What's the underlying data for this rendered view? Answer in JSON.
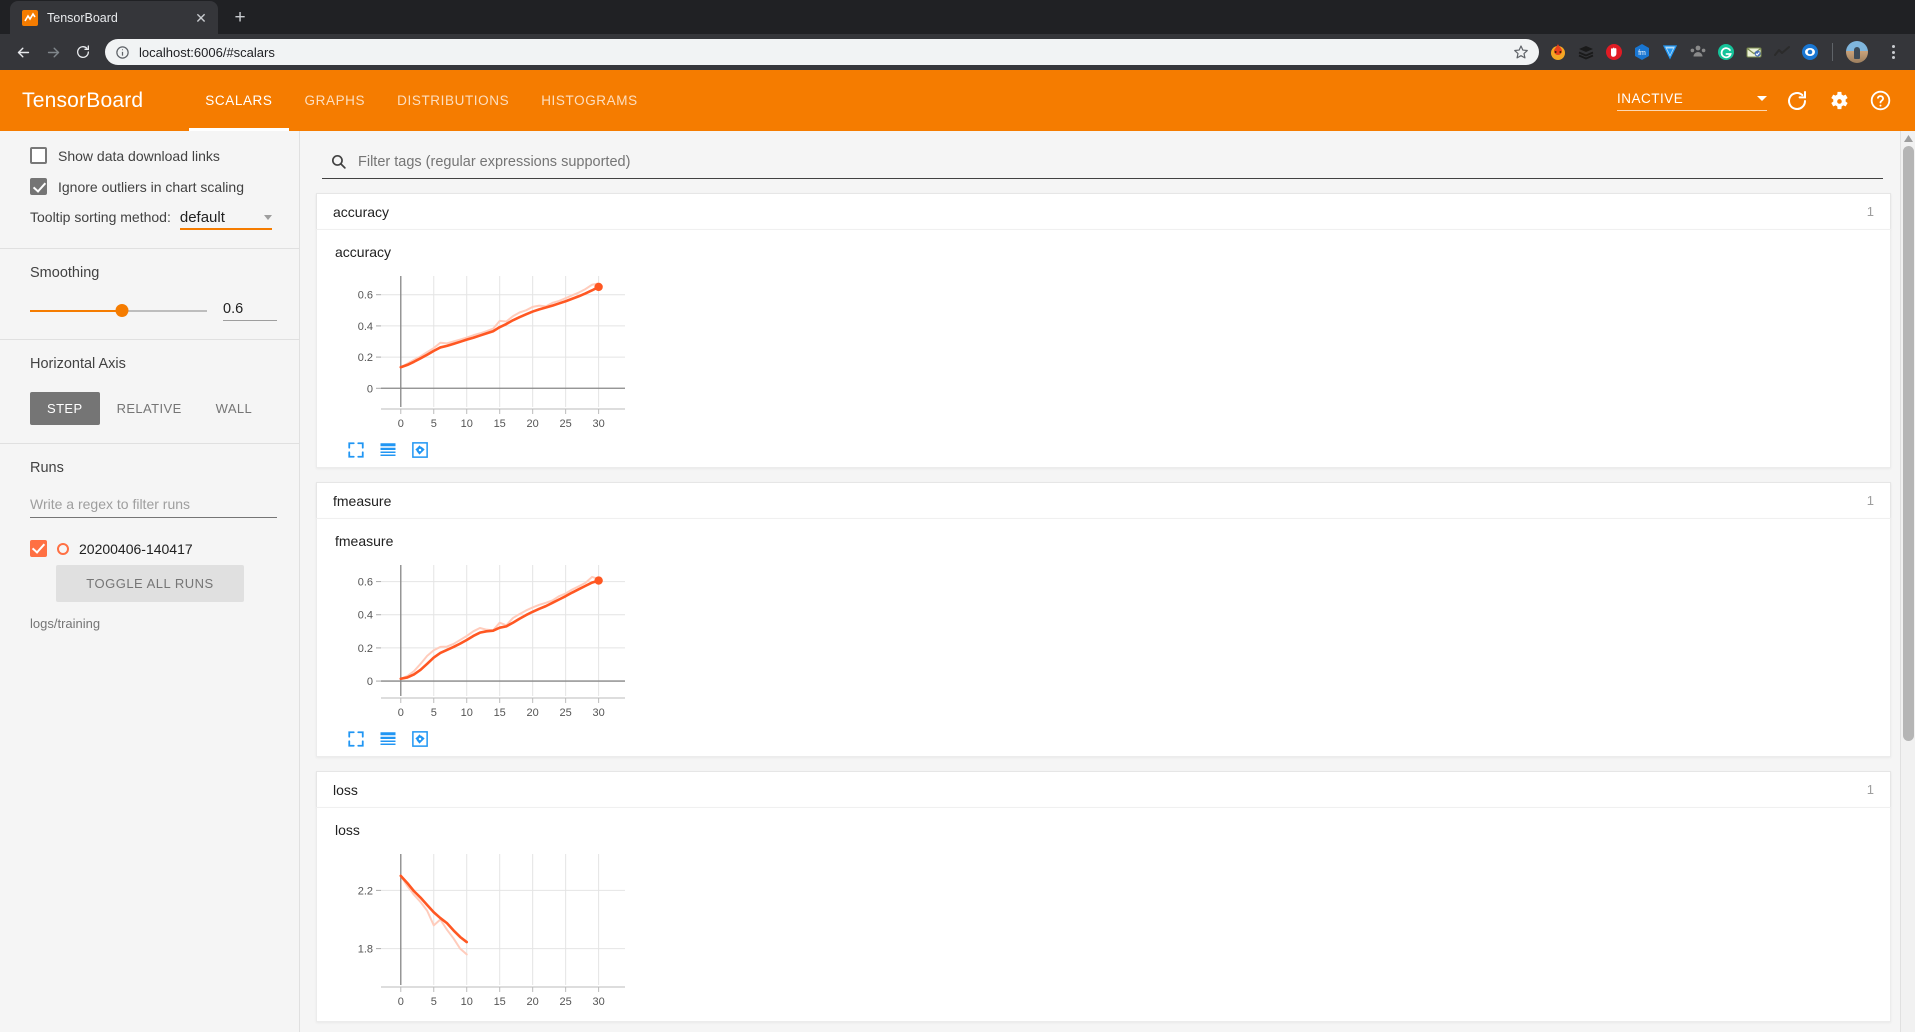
{
  "browser": {
    "tab": {
      "title": "TensorBoard",
      "favicon_icon": "tensorboard-favicon",
      "close_icon": "close-icon"
    },
    "new_tab_label": "+",
    "nav": {
      "back_icon": "back-arrow-icon",
      "forward_icon": "forward-arrow-icon",
      "reload_icon": "reload-icon"
    },
    "omnibox": {
      "url": "localhost:6006/#scalars",
      "info_icon": "site-info-icon",
      "star_icon": "bookmark-star-icon"
    },
    "extensions": [
      "extension-flame-icon",
      "extension-stack-icon",
      "extension-stophand-icon",
      "extension-fm-icon",
      "extension-shield-icon",
      "extension-people-icon",
      "extension-grammarly-icon",
      "extension-mail-icon",
      "extension-wave-icon",
      "extension-eye-icon"
    ],
    "profile_icon": "profile-avatar",
    "menu_icon": "browser-menu-icon"
  },
  "header": {
    "logo": "TensorBoard",
    "tabs": [
      {
        "label": "SCALARS",
        "active": true
      },
      {
        "label": "GRAPHS",
        "active": false
      },
      {
        "label": "DISTRIBUTIONS",
        "active": false
      },
      {
        "label": "HISTOGRAMS",
        "active": false
      }
    ],
    "status_select": {
      "value": "INACTIVE",
      "caret_icon": "chevron-down-icon"
    },
    "refresh_icon": "refresh-icon",
    "settings_icon": "gear-icon",
    "help_icon": "help-circle-icon",
    "brand_color": "#f57c00"
  },
  "sidebar": {
    "show_download_links": {
      "label": "Show data download links",
      "checked": false
    },
    "ignore_outliers": {
      "label": "Ignore outliers in chart scaling",
      "checked": true
    },
    "tooltip_sorting": {
      "label": "Tooltip sorting method:",
      "value": "default",
      "caret_icon": "chevron-down-icon"
    },
    "smoothing": {
      "title": "Smoothing",
      "value": "0.6",
      "percent": 52
    },
    "horizontal_axis": {
      "title": "Horizontal Axis",
      "options": [
        {
          "label": "STEP",
          "active": true
        },
        {
          "label": "RELATIVE",
          "active": false
        },
        {
          "label": "WALL",
          "active": false
        }
      ]
    },
    "runs": {
      "title": "Runs",
      "filter_placeholder": "Write a regex to filter runs",
      "items": [
        {
          "name": "20200406-140417",
          "checked": true,
          "color": "#ff7043"
        }
      ],
      "toggle_all_label": "TOGGLE ALL RUNS",
      "logdir": "logs/training"
    }
  },
  "main": {
    "filter": {
      "placeholder": "Filter tags (regular expressions supported)",
      "icon": "search-icon",
      "value": ""
    },
    "groups": [
      {
        "title": "accuracy",
        "count": "1"
      },
      {
        "title": "fmeasure",
        "count": "1"
      },
      {
        "title": "loss",
        "count": "1"
      }
    ],
    "chart_tools": [
      "fullscreen-expand-icon",
      "data-table-icon",
      "fit-domain-icon"
    ],
    "scrollbar": {
      "up_arrow_icon": "scroll-up-arrow-icon"
    }
  },
  "chart_data": [
    {
      "type": "line",
      "title": "accuracy",
      "xlabel": "",
      "ylabel": "",
      "xlim": [
        -3,
        34
      ],
      "ylim": [
        -0.12,
        0.72
      ],
      "xticks": [
        0,
        5,
        10,
        15,
        20,
        25,
        30
      ],
      "yticks": [
        0,
        0.2,
        0.4,
        0.6
      ],
      "grid": true,
      "legend": "none",
      "series": [
        {
          "name": "20200406-140417 (raw)",
          "color": "#ffccbc",
          "x": [
            0,
            1,
            2,
            3,
            4,
            5,
            6,
            7,
            8,
            9,
            10,
            11,
            12,
            13,
            14,
            15,
            16,
            17,
            18,
            19,
            20,
            21,
            22,
            23,
            24,
            25,
            26,
            27,
            28,
            29,
            30
          ],
          "y": [
            0.135,
            0.158,
            0.182,
            0.205,
            0.232,
            0.258,
            0.292,
            0.288,
            0.3,
            0.312,
            0.325,
            0.34,
            0.352,
            0.366,
            0.382,
            0.432,
            0.428,
            0.462,
            0.486,
            0.5,
            0.522,
            0.53,
            0.525,
            0.548,
            0.56,
            0.578,
            0.596,
            0.614,
            0.636,
            0.664,
            0.672
          ]
        },
        {
          "name": "20200406-140417 (smoothed)",
          "color": "#ff5722",
          "x": [
            0,
            1,
            2,
            3,
            4,
            5,
            6,
            7,
            8,
            9,
            10,
            11,
            12,
            13,
            14,
            15,
            16,
            17,
            18,
            19,
            20,
            21,
            22,
            23,
            24,
            25,
            26,
            27,
            28,
            29,
            30
          ],
          "y": [
            0.135,
            0.15,
            0.17,
            0.192,
            0.215,
            0.24,
            0.262,
            0.272,
            0.285,
            0.298,
            0.312,
            0.324,
            0.338,
            0.352,
            0.366,
            0.392,
            0.412,
            0.436,
            0.456,
            0.474,
            0.492,
            0.506,
            0.518,
            0.53,
            0.544,
            0.558,
            0.574,
            0.59,
            0.608,
            0.628,
            0.65
          ]
        }
      ],
      "end_marker": {
        "x": 30,
        "y": 0.65,
        "color": "#ff5722"
      }
    },
    {
      "type": "line",
      "title": "fmeasure",
      "xlabel": "",
      "ylabel": "",
      "xlim": [
        -3,
        34
      ],
      "ylim": [
        -0.09,
        0.7
      ],
      "xticks": [
        0,
        5,
        10,
        15,
        20,
        25,
        30
      ],
      "yticks": [
        0,
        0.2,
        0.4,
        0.6
      ],
      "grid": true,
      "legend": "none",
      "series": [
        {
          "name": "20200406-140417 (raw)",
          "color": "#ffccbc",
          "x": [
            0,
            1,
            2,
            3,
            4,
            5,
            6,
            7,
            8,
            9,
            10,
            11,
            12,
            13,
            14,
            15,
            16,
            17,
            18,
            19,
            20,
            21,
            22,
            23,
            24,
            25,
            26,
            27,
            28,
            29,
            30
          ],
          "y": [
            0.014,
            0.03,
            0.06,
            0.104,
            0.152,
            0.186,
            0.206,
            0.208,
            0.224,
            0.248,
            0.272,
            0.3,
            0.32,
            0.31,
            0.306,
            0.352,
            0.336,
            0.38,
            0.404,
            0.426,
            0.444,
            0.46,
            0.472,
            0.486,
            0.512,
            0.528,
            0.552,
            0.572,
            0.592,
            0.628,
            0.616
          ]
        },
        {
          "name": "20200406-140417 (smoothed)",
          "color": "#ff5722",
          "x": [
            0,
            1,
            2,
            3,
            4,
            5,
            6,
            7,
            8,
            9,
            10,
            11,
            12,
            13,
            14,
            15,
            16,
            17,
            18,
            19,
            20,
            21,
            22,
            23,
            24,
            25,
            26,
            27,
            28,
            29,
            30
          ],
          "y": [
            0.014,
            0.022,
            0.04,
            0.068,
            0.104,
            0.142,
            0.17,
            0.188,
            0.206,
            0.226,
            0.248,
            0.272,
            0.292,
            0.3,
            0.304,
            0.322,
            0.33,
            0.352,
            0.376,
            0.398,
            0.418,
            0.436,
            0.452,
            0.472,
            0.492,
            0.512,
            0.534,
            0.554,
            0.574,
            0.594,
            0.606
          ]
        }
      ],
      "end_marker": {
        "x": 30,
        "y": 0.606,
        "color": "#ff5722"
      }
    },
    {
      "type": "line",
      "title": "loss",
      "xlabel": "",
      "ylabel": "",
      "xlim": [
        -3,
        34
      ],
      "ylim": [
        1.55,
        2.45
      ],
      "xticks": [
        0,
        5,
        10,
        15,
        20,
        25,
        30
      ],
      "yticks": [
        1.8,
        2.2
      ],
      "grid": true,
      "legend": "none",
      "series": [
        {
          "name": "20200406-140417 (raw)",
          "color": "#ffccbc",
          "x": [
            0,
            1,
            2,
            3,
            4,
            5,
            6,
            7,
            8,
            9,
            10
          ],
          "y": [
            2.3,
            2.23,
            2.17,
            2.12,
            2.06,
            1.96,
            2.0,
            1.93,
            1.87,
            1.8,
            1.76
          ]
        },
        {
          "name": "20200406-140417 (smoothed)",
          "color": "#ff5722",
          "x": [
            0,
            1,
            2,
            3,
            4,
            5,
            6,
            7,
            8,
            9,
            10
          ],
          "y": [
            2.3,
            2.25,
            2.195,
            2.15,
            2.1,
            2.05,
            2.01,
            1.975,
            1.925,
            1.88,
            1.845
          ]
        }
      ],
      "end_marker": null
    }
  ]
}
